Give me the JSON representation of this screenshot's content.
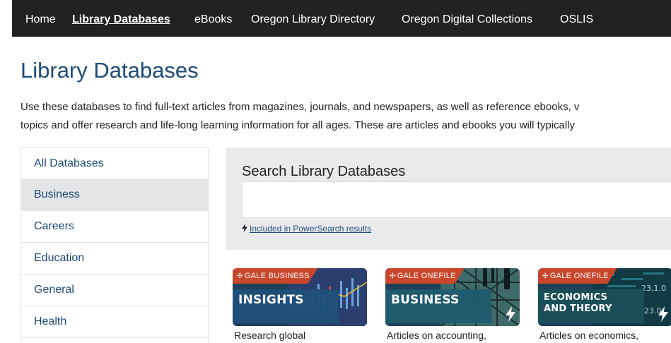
{
  "nav": {
    "items": [
      {
        "label": "Home",
        "active": false
      },
      {
        "label": "Library Databases",
        "active": true
      },
      {
        "label": "eBooks",
        "active": false
      },
      {
        "label": "Oregon Library Directory",
        "active": false
      },
      {
        "label": "Oregon Digital Collections",
        "active": false
      },
      {
        "label": "OSLIS",
        "active": false
      }
    ]
  },
  "page": {
    "title": "Library Databases",
    "intro_line1": "Use these databases to find full-text articles from magazines, journals, and newspapers, as well as reference ebooks, v",
    "intro_line2": "topics and offer research and life-long learning information for all ages.  These are articles and ebooks you will typically"
  },
  "subjects": {
    "selected": "Business",
    "items": [
      "All Databases",
      "Business",
      "Careers",
      "Education",
      "General",
      "Health"
    ]
  },
  "search": {
    "heading": "Search Library Databases",
    "input_value": "",
    "powersearch_icon": "bolt-icon",
    "powersearch_link": "Included in PowerSearch results"
  },
  "databases": [
    {
      "brand": "GALE BUSINESS",
      "name": "INSIGHTS",
      "description": "Research global",
      "powersearch": false,
      "colors": {
        "band": "#1f4f7a",
        "tag": "#c9462c"
      }
    },
    {
      "brand": "GALE ONEFILE",
      "name": "BUSINESS",
      "description": "Articles on accounting,",
      "powersearch": true,
      "colors": {
        "band": "#1f5c6e",
        "tag": "#c9462c"
      }
    },
    {
      "brand": "GALE ONEFILE",
      "name": "ECONOMICS\nAND THEORY",
      "description": "Articles on economics,",
      "powersearch": true,
      "colors": {
        "band": "#1a4f5a",
        "tag": "#c9462c"
      }
    }
  ],
  "colors": {
    "nav_bg": "#222222",
    "title": "#1d4b79",
    "link": "#1d4b79",
    "selected_bg": "#e3e5e7",
    "panel_bg": "#e9eaeb"
  }
}
